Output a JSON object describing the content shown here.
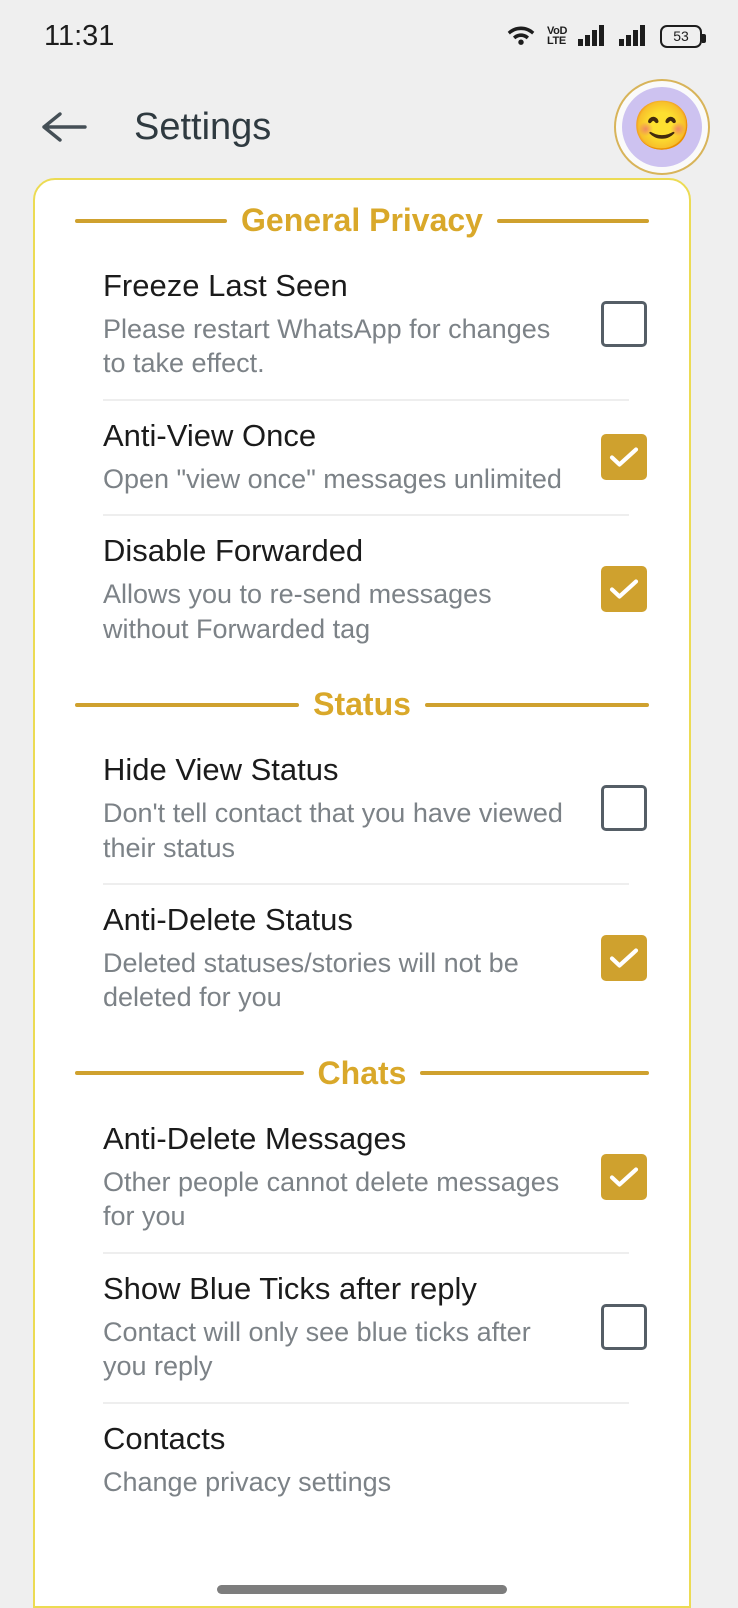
{
  "status_bar": {
    "time": "11:31",
    "wifi_icon": "wifi-icon",
    "volte_line1": "VoD",
    "volte_line2": "LTE",
    "signal1_icon": "signal-bars-icon",
    "signal2_icon": "signal-bars-icon",
    "battery_level": "53"
  },
  "app_bar": {
    "back_icon": "back-arrow-icon",
    "title": "Settings",
    "avatar_emoji": "😊"
  },
  "colors": {
    "accent_gold": "#cfa12e",
    "section_title": "#d9a82a",
    "card_border": "#ecdb53",
    "checkbox_off_border": "#555e66",
    "page_bg": "#efefef"
  },
  "sections": [
    {
      "title": "General Privacy",
      "rows": [
        {
          "title": "Freeze Last Seen",
          "sub": "Please restart WhatsApp for changes to take effect.",
          "checked": false
        },
        {
          "title": "Anti-View Once",
          "sub": "Open \"view once\" messages unlimited",
          "checked": true
        },
        {
          "title": "Disable Forwarded",
          "sub": "Allows you to re-send messages without Forwarded tag",
          "checked": true
        }
      ]
    },
    {
      "title": "Status",
      "rows": [
        {
          "title": "Hide View Status",
          "sub": "Don't tell contact that you have viewed their status",
          "checked": false
        },
        {
          "title": "Anti-Delete Status",
          "sub": "Deleted statuses/stories will not be deleted for you",
          "checked": true
        }
      ]
    },
    {
      "title": "Chats",
      "rows": [
        {
          "title": "Anti-Delete Messages",
          "sub": "Other people cannot delete messages for you",
          "checked": true
        },
        {
          "title": "Show Blue Ticks after reply",
          "sub": "Contact will only see blue ticks after you reply",
          "checked": false
        },
        {
          "title": "Contacts",
          "sub": "Change privacy settings",
          "checked": null
        }
      ]
    }
  ],
  "nav": {
    "handle": "gesture-nav-handle"
  }
}
